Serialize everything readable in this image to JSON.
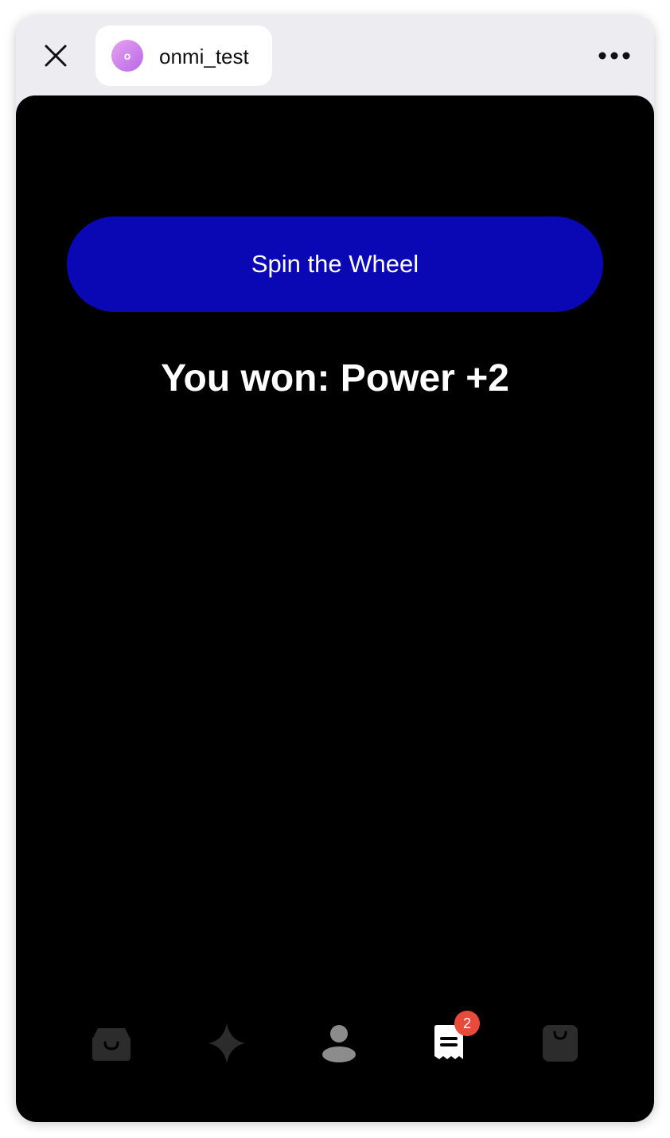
{
  "window": {
    "app_name": "onmi_test",
    "avatar_letter": "o",
    "avatar_colors": [
      "#e7a2f0",
      "#b768e6"
    ],
    "close_icon": "close-icon",
    "more_icon": "more-horizontal-icon"
  },
  "main": {
    "spin_button_label": "Spin the Wheel",
    "spin_button_color": "#0a08b4",
    "result_text": "You won: Power +2"
  },
  "bottom_nav": {
    "items": [
      {
        "icon": "shop-bag-icon",
        "active": false
      },
      {
        "icon": "sparkle-icon",
        "active": false
      },
      {
        "icon": "profile-icon",
        "active": false
      },
      {
        "icon": "receipt-icon",
        "active": true,
        "badge": "2"
      },
      {
        "icon": "shopping-bag-icon",
        "active": false
      }
    ],
    "badge_color": "#e84a3b"
  }
}
